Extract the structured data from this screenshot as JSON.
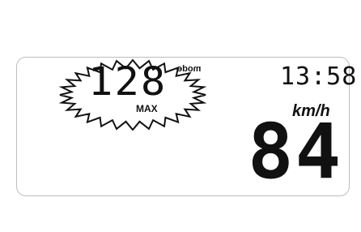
{
  "display": {
    "max_speed": "128",
    "max_label": "MAX",
    "mode_label": "mode",
    "clock": "13:58",
    "speed_unit": "km/h",
    "current_speed": "84",
    "colors": {
      "segment": "#111111",
      "frame": "#bdbdbd",
      "background": "#ffffff"
    },
    "icons": [
      "starburst-icon"
    ]
  }
}
